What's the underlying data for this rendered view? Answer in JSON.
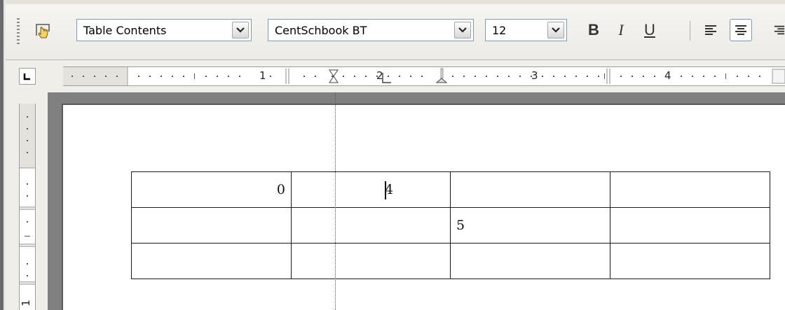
{
  "toolbar": {
    "navigator_icon": "hand-navigator-icon",
    "paragraph_style": {
      "value": "Table Contents"
    },
    "font_name": {
      "value": "CentSchbook BT"
    },
    "font_size": {
      "value": "12"
    },
    "bold_label": "B",
    "italic_label": "I",
    "underline_label": "U",
    "align_left_icon": "align-left-icon",
    "align_center_icon": "align-center-icon",
    "align_right_icon": "align-right-icon"
  },
  "ruler": {
    "tab_type_icon": "left-tab-stop-icon",
    "labels": [
      "1",
      "2",
      "3",
      "4"
    ],
    "vertical_label": "1"
  },
  "table": {
    "rows": [
      [
        "0",
        "4",
        "",
        ""
      ],
      [
        "",
        "",
        "5",
        ""
      ],
      [
        "",
        "",
        "",
        ""
      ]
    ]
  }
}
